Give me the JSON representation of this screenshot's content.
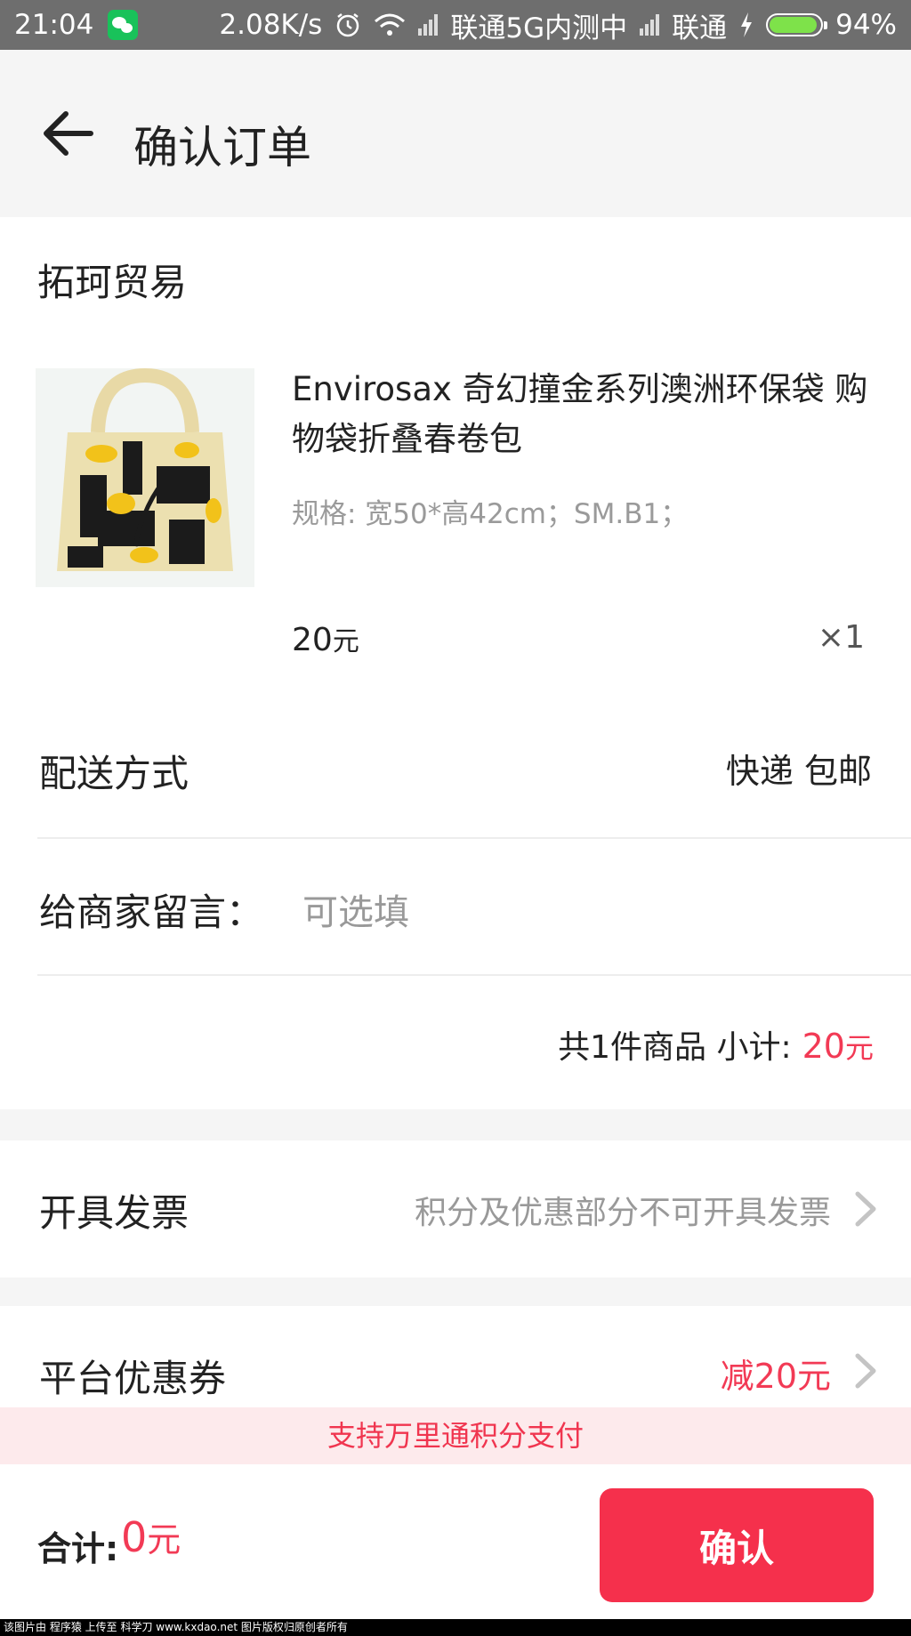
{
  "status_bar": {
    "time": "21:04",
    "net_speed": "2.08K/s",
    "carrier1": "联通5G内测中",
    "carrier2": "联通",
    "battery": "94%",
    "battery_level": 0.94,
    "icons": [
      "wechat-icon",
      "alarm-icon",
      "wifi-icon",
      "signal-icon",
      "charging-icon",
      "battery-icon"
    ]
  },
  "header": {
    "title": "确认订单",
    "back_icon": "arrow-left-icon"
  },
  "order": {
    "store_name": "拓珂贸易",
    "product": {
      "name": "Envirosax 奇幻撞金系列澳洲环保袋 购物袋折叠春卷包",
      "spec": "规格: 宽50*高42cm；SM.B1；",
      "price": "20",
      "price_unit": "元",
      "quantity": "×1"
    },
    "delivery": {
      "label": "配送方式",
      "value": "快递  包邮"
    },
    "message": {
      "label": "给商家留言：",
      "placeholder": "可选填",
      "value": ""
    },
    "subtotal": {
      "label": "共1件商品 小计:",
      "amount": "20",
      "unit": "元"
    }
  },
  "invoice": {
    "label": "开具发票",
    "note": "积分及优惠部分不可开具发票"
  },
  "coupon": {
    "label": "平台优惠券",
    "value": "减20元"
  },
  "points_banner": "支持万里通积分支付",
  "footer": {
    "total_label": "合计:",
    "total_amount": "0",
    "total_unit": "元",
    "confirm_label": "确认"
  },
  "watermark": "该图片由 程序猿 上传至 科学刀 www.kxdao.net 图片版权归原创者所有",
  "colors": {
    "accent": "#f5304c",
    "price_red": "#f23a55",
    "banner_bg": "#fdeaec",
    "status_bar": "#6e6e6e"
  }
}
